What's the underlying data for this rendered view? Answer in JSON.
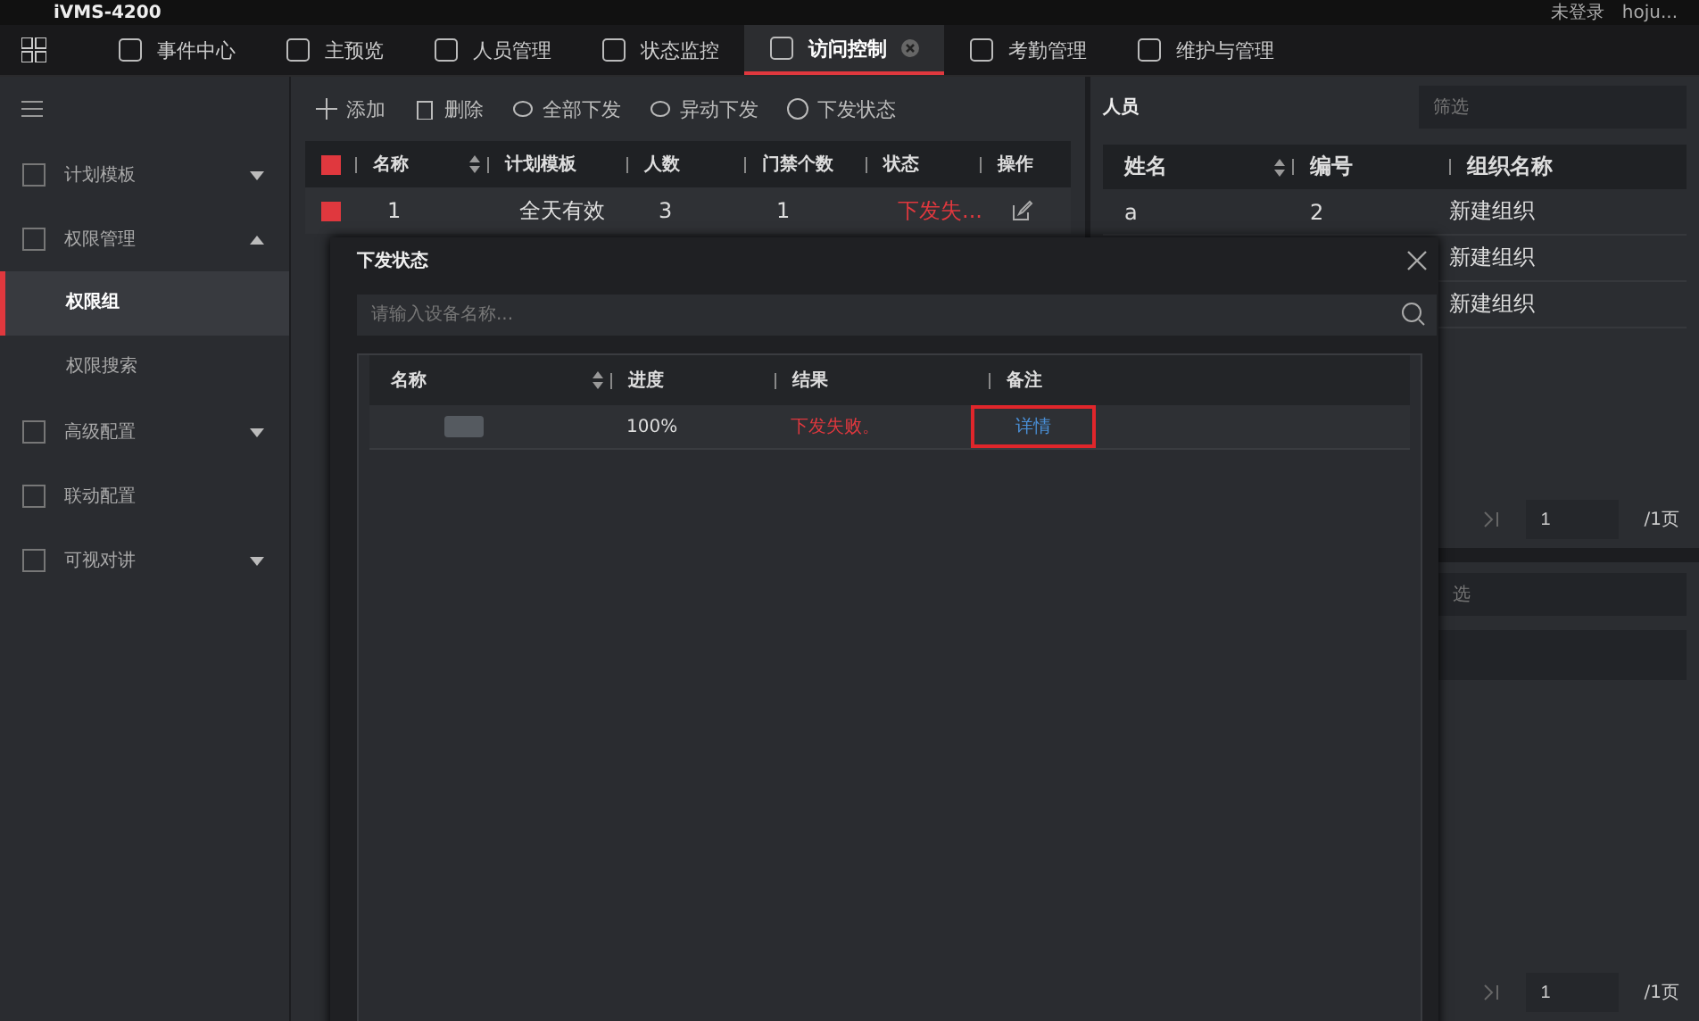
{
  "app": {
    "title": "iVMS-4200",
    "login_status": "未登录",
    "user": "hoju..."
  },
  "nav_tabs": [
    {
      "label": "事件中心",
      "selected": false,
      "closable": false
    },
    {
      "label": "主预览",
      "selected": false,
      "closable": false
    },
    {
      "label": "人员管理",
      "selected": false,
      "closable": false
    },
    {
      "label": "状态监控",
      "selected": false,
      "closable": false
    },
    {
      "label": "访问控制",
      "selected": true,
      "closable": true
    },
    {
      "label": "考勤管理",
      "selected": false,
      "closable": false
    },
    {
      "label": "维护与管理",
      "selected": false,
      "closable": false
    }
  ],
  "sidebar": {
    "items": [
      {
        "label": "计划模板",
        "kind": "group",
        "expanded": false
      },
      {
        "label": "权限管理",
        "kind": "group",
        "expanded": true,
        "children": [
          {
            "label": "权限组",
            "selected": true
          },
          {
            "label": "权限搜索",
            "selected": false
          }
        ]
      },
      {
        "label": "高级配置",
        "kind": "group",
        "expanded": false
      },
      {
        "label": "联动配置",
        "kind": "item"
      },
      {
        "label": "可视对讲",
        "kind": "group",
        "expanded": false
      }
    ]
  },
  "toolbar": [
    "添加",
    "删除",
    "全部下发",
    "异动下发",
    "下发状态"
  ],
  "groups_table": {
    "all_checked": true,
    "columns": [
      "名称",
      "计划模板",
      "人数",
      "门禁个数",
      "状态",
      "操作"
    ],
    "rows": [
      {
        "checked": true,
        "name": "1",
        "template": "全天有效",
        "persons": "3",
        "doors": "1",
        "status": "下发失..."
      }
    ]
  },
  "persons_panel": {
    "title": "人员",
    "filter": {
      "placeholder": "筛选"
    },
    "columns": [
      "姓名",
      "编号",
      "组织名称"
    ],
    "rows": [
      {
        "name": "a",
        "number": "2",
        "org": "新建组织"
      },
      {
        "org": "新建组织"
      },
      {
        "org": "新建组织"
      }
    ],
    "pager": {
      "page": "1",
      "total": "/1页"
    }
  },
  "lower_panel": {
    "filter": {
      "placeholder": "选"
    },
    "pager": {
      "page": "1",
      "total": "/1页"
    }
  },
  "dialog": {
    "title": "下发状态",
    "search": {
      "placeholder": "请输入设备名称..."
    },
    "columns": [
      "名称",
      "进度",
      "结果",
      "备注"
    ],
    "rows": [
      {
        "progress": "100%",
        "result": "下发失败。",
        "remark": "详情",
        "highlighted": true
      }
    ]
  }
}
